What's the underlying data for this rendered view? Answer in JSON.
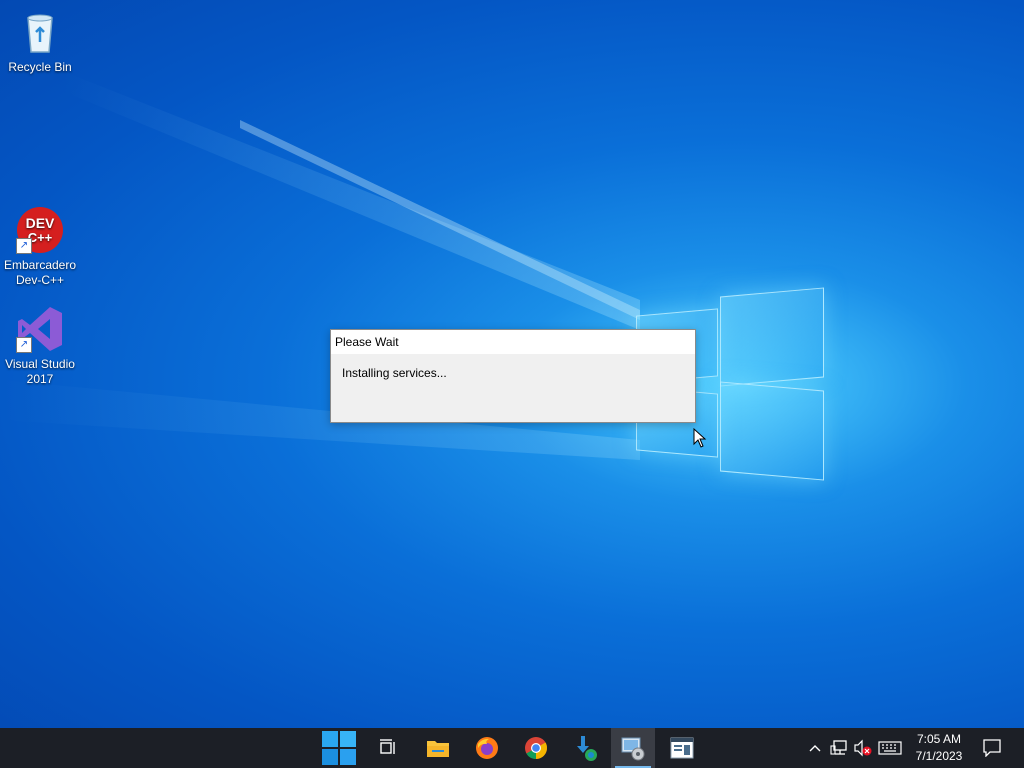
{
  "desktop": {
    "icons": [
      {
        "label": "Recycle Bin",
        "icon": "recycle-bin-icon"
      },
      {
        "label": "Embarcadero Dev-C++",
        "icon": "devcpp-icon",
        "badge": "DEV C++"
      },
      {
        "label": "Visual Studio 2017",
        "icon": "visual-studio-icon"
      }
    ]
  },
  "dialog": {
    "title": "Please Wait",
    "message": "Installing services..."
  },
  "taskbar": {
    "apps": [
      {
        "name": "Start",
        "icon": "start-icon"
      },
      {
        "name": "Task View",
        "icon": "task-view-icon"
      },
      {
        "name": "File Explorer",
        "icon": "file-explorer-icon"
      },
      {
        "name": "Firefox",
        "icon": "firefox-icon"
      },
      {
        "name": "Chrome",
        "icon": "chrome-icon"
      },
      {
        "name": "Edge Installer",
        "icon": "edge-installer-icon"
      },
      {
        "name": "Setup",
        "icon": "setup-icon",
        "active": true
      },
      {
        "name": "App",
        "icon": "app-window-icon"
      }
    ],
    "tray": [
      "chevron-up-icon",
      "network-icon",
      "volume-muted-icon",
      "keyboard-icon"
    ],
    "clock": {
      "time": "7:05 AM",
      "date": "7/1/2023"
    },
    "notifications_icon": "notification-icon"
  },
  "colors": {
    "taskbar": "#1c1f26",
    "desktop_accent": "#0a6fd8",
    "active_indicator": "#76b9ed"
  }
}
